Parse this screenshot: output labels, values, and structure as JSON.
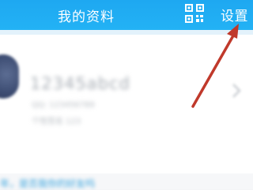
{
  "header": {
    "title": "我的资料",
    "qr_icon": "qr-code-icon",
    "settings_label": "设置",
    "background": "#1ea8f1"
  },
  "profile": {
    "name": "12345abcd",
    "line1": "QQ: 123456789",
    "line2": "个性签名 123",
    "avatar_icon": "avatar",
    "chevron_icon": "chevron-right-icon"
  },
  "footer": {
    "text": "年，是否我你的好友吗"
  },
  "annotation": {
    "arrow_color": "#c0392b",
    "arrow_icon": "pointer-arrow"
  }
}
